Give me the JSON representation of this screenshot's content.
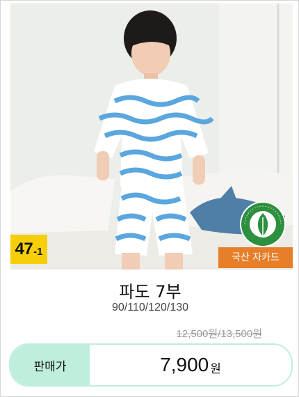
{
  "product": {
    "badge_number": "47",
    "badge_suffix": "-1",
    "organic_logo_text": "ORGANIC 100 content standard",
    "origin_tag": "국산 자카드",
    "title": "파도 7부",
    "sizes": "90/110/120/130",
    "original_price": "12,500원/13,500원",
    "sale_label": "판매가",
    "sale_price": "7,900",
    "currency": "원"
  },
  "colors": {
    "badge_yellow": "#f6cf0a",
    "origin_tag_orange": "#e77f2a",
    "price_mint": "#bfeedd",
    "organic_green": "#2e8f3e"
  }
}
